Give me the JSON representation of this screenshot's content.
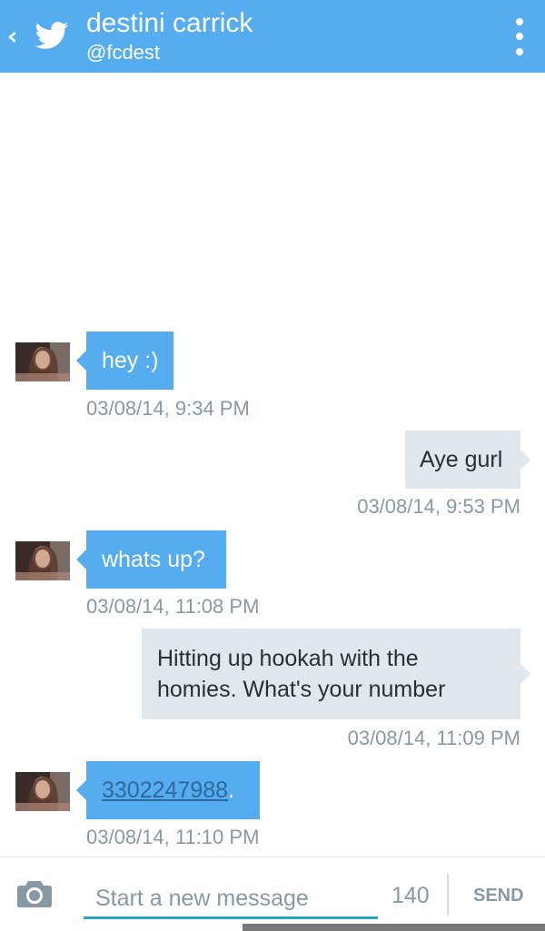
{
  "header": {
    "back_icon": "chevron-left-icon",
    "logo_icon": "twitter-bird-icon",
    "name": "destini carrick",
    "handle": "@fcdest",
    "menu_icon": "overflow-menu-icon",
    "background": "#55acee"
  },
  "messages": [
    {
      "direction": "received",
      "text": "hey :)",
      "timestamp": "03/08/14, 9:34 PM"
    },
    {
      "direction": "sent",
      "text": "Aye gurl",
      "timestamp": "03/08/14, 9:53 PM"
    },
    {
      "direction": "received",
      "text": "whats up?",
      "timestamp": "03/08/14, 11:08 PM"
    },
    {
      "direction": "sent",
      "text_line1": "Hitting up hookah with the",
      "text_line2": "homies. What's your number",
      "timestamp": "03/08/14, 11:09 PM"
    },
    {
      "direction": "received",
      "phone": "3302247988",
      "suffix": ".",
      "timestamp": "03/08/14, 11:10 PM"
    }
  ],
  "composer": {
    "camera_icon": "camera-icon",
    "placeholder": "Start a new message",
    "char_count": "140",
    "send_label": "SEND"
  },
  "colors": {
    "accent": "#55acee",
    "sent_bubble": "#e1e8ed",
    "muted_text": "#8899a6",
    "input_underline": "#2ba3c7"
  }
}
